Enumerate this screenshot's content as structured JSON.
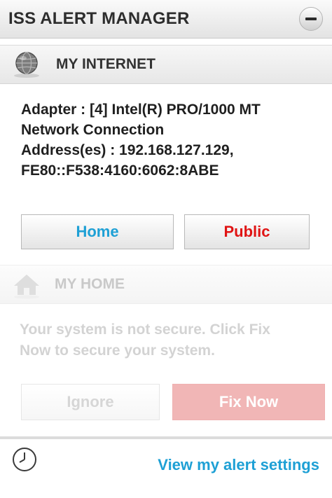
{
  "window": {
    "title": "ISS ALERT MANAGER",
    "collapse_icon": "minus-icon"
  },
  "my_internet": {
    "header": "MY INTERNET",
    "icon": "globe-icon",
    "adapter_line1": "Adapter : [4] Intel(R) PRO/1000 MT",
    "adapter_line2": "Network Connection",
    "address_line1": "Address(es) : 192.168.127.129,",
    "address_line2": "FE80::F538:4160:6062:8ABE",
    "home_button": "Home",
    "public_button": "Public"
  },
  "my_home": {
    "header": "MY HOME",
    "icon": "house-icon",
    "message_line1": "Your system is not secure. Click Fix",
    "message_line2": "Now to secure your system.",
    "ignore_button": "Ignore",
    "fix_button": "Fix Now"
  },
  "footer": {
    "icon": "clock-icon",
    "settings_link": "View my alert settings"
  },
  "colors": {
    "accent_blue": "#1ea0d5",
    "public_red": "#e01414",
    "fix_disabled": "#f1b6b6"
  }
}
